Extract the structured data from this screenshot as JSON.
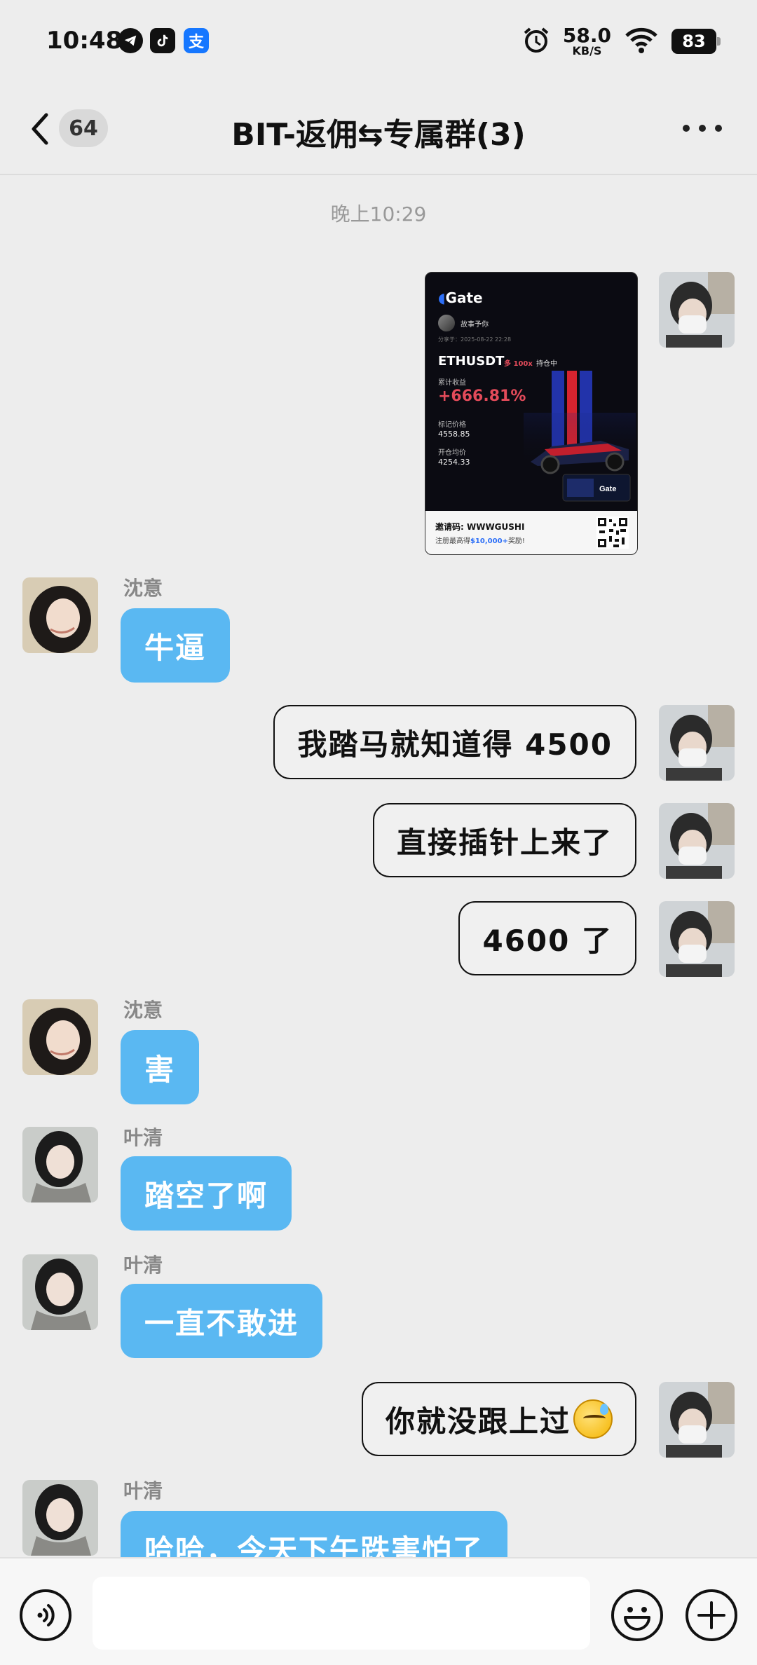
{
  "status_bar": {
    "time": "10:48",
    "app_icons": [
      "telegram-icon",
      "tiktok-icon",
      "alipay-icon"
    ],
    "alipay_glyph": "支",
    "net_speed_value": "58.0",
    "net_speed_unit": "KB/S",
    "battery": "83"
  },
  "header": {
    "back_icon": "chevron-left-icon",
    "unread_count": "64",
    "title": "BIT-返佣⇆专属群(3)",
    "more_icon": "more-horizontal-icon"
  },
  "chat": {
    "timestamp": "晚上10:29",
    "poster": {
      "brand": "Gate",
      "username": "故事予你",
      "share_time": "分享于：2025-08-22 22:28",
      "pair": "ETHUSDT",
      "leverage": "多 100x",
      "holding": "持仓中",
      "cum_label": "累计收益",
      "cum_pnl": "+666.81%",
      "mark_label": "标记价格",
      "mark_price": "4558.85",
      "entry_label": "开仓均价",
      "entry_price": "4254.33",
      "invite_label": "邀请码: WWWGUSHI",
      "reg_prefix": "注册最高得",
      "reg_amount": "$10,000+",
      "reg_suffix": "奖励!"
    },
    "messages": [
      {
        "sender": "沈意",
        "text": "牛逼"
      },
      {
        "text": "我踏马就知道得 4500"
      },
      {
        "text": "直接插针上来了"
      },
      {
        "text": "4600 了"
      },
      {
        "sender": "沈意",
        "text": "害"
      },
      {
        "sender": "叶清",
        "text": "踏空了啊"
      },
      {
        "sender": "叶清",
        "text": "一直不敢进"
      },
      {
        "text": "你就没跟上过"
      },
      {
        "sender": "叶清",
        "text": "哈哈，今天下午跌害怕了"
      }
    ]
  },
  "bottom_bar": {
    "voice_icon": "voice-icon",
    "emoji_icon": "emoji-icon",
    "plus_icon": "plus-icon",
    "input_value": ""
  },
  "colors": {
    "incoming_bubble": "#5ab8f2",
    "outgoing_bubble": "#f0f0f0",
    "background": "#ededed",
    "pnl_red": "#e34b5a"
  }
}
